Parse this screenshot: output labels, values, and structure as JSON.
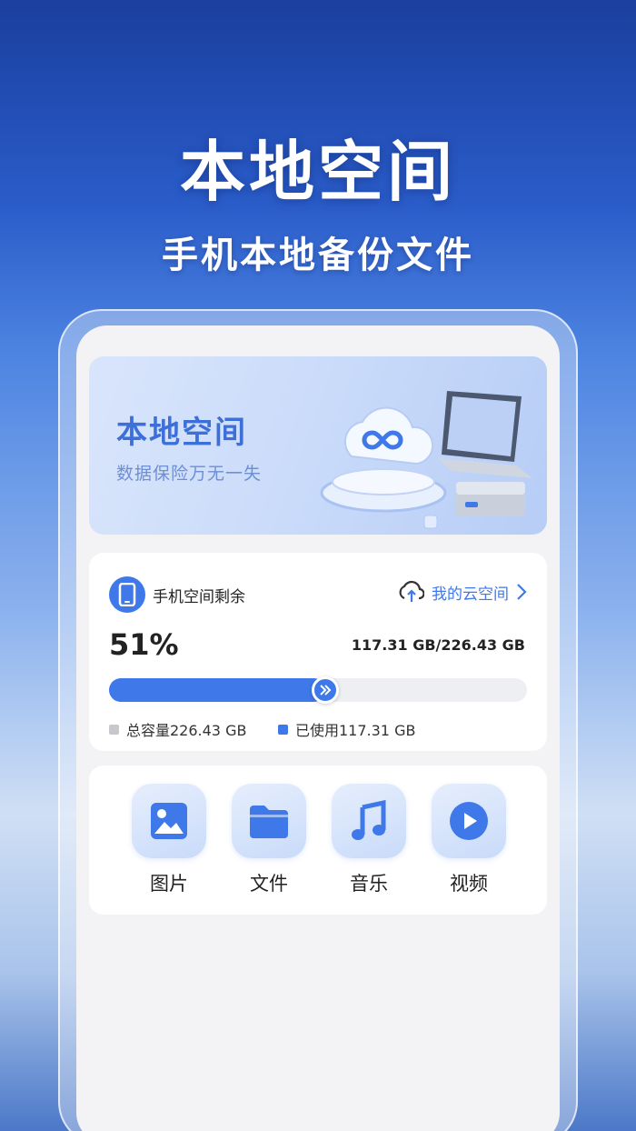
{
  "hero": {
    "title": "本地空间",
    "subtitle": "手机本地备份文件"
  },
  "banner": {
    "title": "本地空间",
    "subtitle": "数据保险万无一失"
  },
  "storage": {
    "label": "手机空间剩余",
    "cloud_link": "我的云空间",
    "percent_text": "51%",
    "used_fraction": 0.518,
    "usage_text": "117.31 GB/226.43 GB",
    "legend_total": "总容量226.43 GB",
    "legend_used": "已使用117.31 GB"
  },
  "categories": [
    {
      "label": "图片",
      "icon": "image-icon"
    },
    {
      "label": "文件",
      "icon": "folder-icon"
    },
    {
      "label": "音乐",
      "icon": "music-note-icon"
    },
    {
      "label": "视频",
      "icon": "play-icon"
    }
  ],
  "colors": {
    "accent": "#3f78e8",
    "legend_total": "#c8c8cc",
    "legend_used": "#3f78e8"
  }
}
